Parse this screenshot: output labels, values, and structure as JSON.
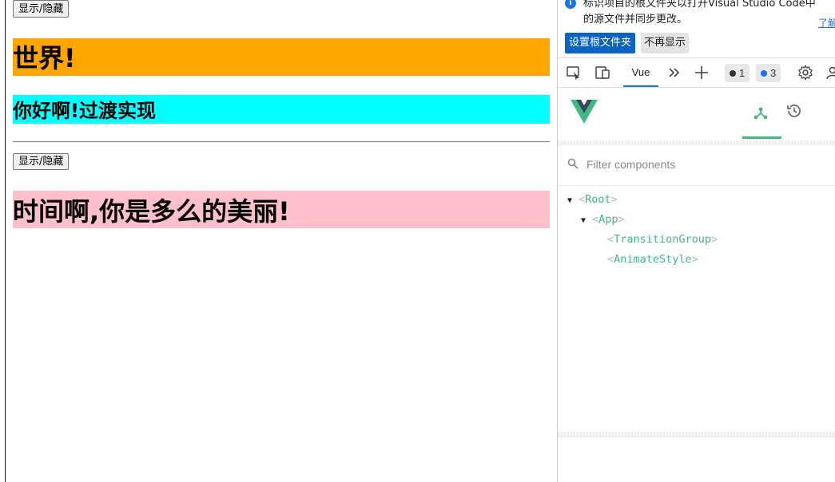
{
  "page": {
    "toggle_button_1": "显示/隐藏",
    "heading_world": "世界!",
    "heading_hello": "你好啊!过渡实现",
    "toggle_button_2": "显示/隐藏",
    "heading_time": "时间啊,你是多么的美丽!",
    "colors": {
      "world_bg": "#ffa500",
      "hello_bg": "#00ffff",
      "time_bg": "#ffc0cb"
    }
  },
  "devtools": {
    "infobar": {
      "text": "标识项目的根文件夹以打开Visual Studio Code中的源文件并同步更改。",
      "learn_more": "了解",
      "set_root_button": "设置根文件夹",
      "dont_show_button": "不再显示"
    },
    "toolbar": {
      "active_tab": "Vue",
      "error_count": "1",
      "message_count": "3",
      "icons": [
        "inspect-icon",
        "device-toolbar-icon",
        "more-tabs-icon",
        "add-tab-icon",
        "settings-icon",
        "user-icon"
      ]
    },
    "vue": {
      "tabs": [
        "components",
        "timeline"
      ],
      "filter_placeholder": "Filter components",
      "tree": [
        {
          "name": "Root",
          "depth": 0,
          "expanded": true
        },
        {
          "name": "App",
          "depth": 1,
          "expanded": true
        },
        {
          "name": "TransitionGroup",
          "depth": 2,
          "expanded": null
        },
        {
          "name": "AnimateStyle",
          "depth": 2,
          "expanded": null
        }
      ],
      "accent": "#42b883"
    }
  }
}
